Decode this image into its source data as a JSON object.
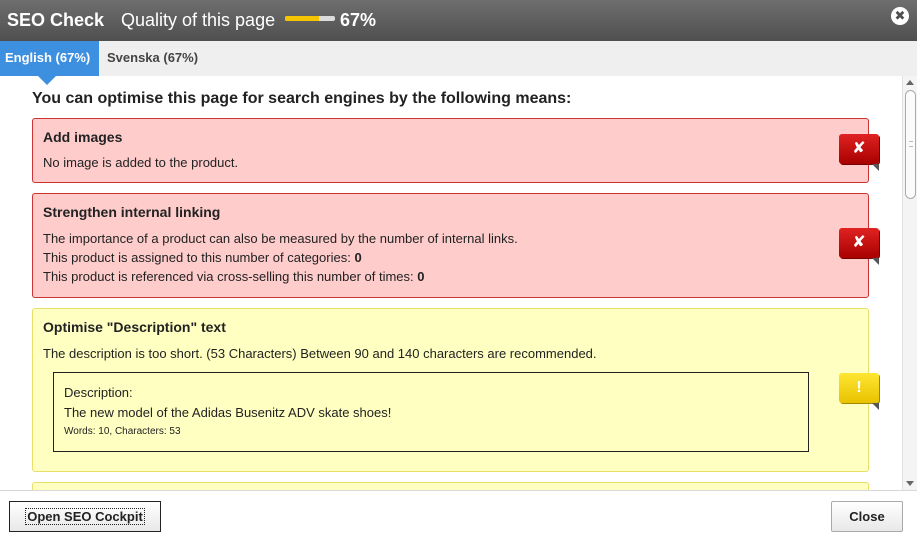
{
  "header": {
    "title": "SEO Check",
    "quality_label": "Quality of this page",
    "quality_value": "67%",
    "quality_fraction": 0.67,
    "close_symbol": "✖"
  },
  "tabs": [
    {
      "label": "English (67%)",
      "active": true
    },
    {
      "label": "Svenska (67%)",
      "active": false
    }
  ],
  "main": {
    "intro": "You can optimise this page for search engines by the following means:",
    "cards": [
      {
        "status": "error",
        "icon": "x-icon",
        "badge_symbol": "✘",
        "title": "Add images",
        "lines": [
          "No image is added to the product."
        ]
      },
      {
        "status": "error",
        "icon": "x-icon",
        "badge_symbol": "✘",
        "title": "Strengthen internal linking",
        "lines": [
          "The importance of a product can also be measured by the number of internal links.",
          "This product is assigned to this number of categories: ",
          "This product is referenced via cross-selling this number of times: "
        ],
        "values": [
          "0",
          "0"
        ]
      },
      {
        "status": "warning",
        "icon": "exclamation-icon",
        "badge_symbol": "!",
        "title": "Optimise \"Description\" text",
        "lines": [
          "The description is too short. (53 Characters) Between 90 and 140 characters are recommended."
        ],
        "box": {
          "label": "Description:",
          "text": "The new model of the Adidas Busenitz ADV skate shoes!",
          "stats": "Words: 10, Characters: 53"
        }
      }
    ]
  },
  "footer": {
    "cockpit_button": "Open SEO Cockpit",
    "close_button": "Close"
  },
  "colors": {
    "header_bg": "#5e5e5e",
    "tab_active": "#3d8fe0",
    "error_bg": "#ffcccc",
    "error_border": "#cc3333",
    "warning_bg": "#ffffc2",
    "quality_fill": "#f5c400"
  }
}
